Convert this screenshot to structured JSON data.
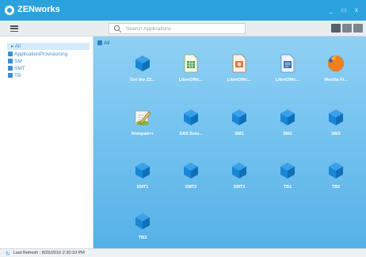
{
  "window": {
    "title": "ZENworks",
    "buttons": {
      "minimize": "_",
      "maximize": "▭",
      "close": "x"
    }
  },
  "toolbar": {
    "search_placeholder": "Search Applications",
    "icons": [
      "menu-icon",
      "search-icon",
      "list-view-icon",
      "grid-view-icon",
      "tile-view-icon"
    ]
  },
  "sidebar": {
    "items": [
      {
        "label": "All",
        "selected": true
      },
      {
        "label": "ApplicationProvisioning",
        "selected": false
      },
      {
        "label": "SM",
        "selected": false
      },
      {
        "label": "SMT",
        "selected": false
      },
      {
        "label": "TB",
        "selected": false
      }
    ]
  },
  "main": {
    "breadcrumb": "All",
    "tiles": [
      {
        "label": "Get the Z2...",
        "icon": "cube-icon"
      },
      {
        "label": "LibreOffic...",
        "icon": "libreoffice-calc-icon"
      },
      {
        "label": "LibreOffic...",
        "icon": "libreoffice-impress-icon"
      },
      {
        "label": "LibreOffic...",
        "icon": "libreoffice-writer-icon"
      },
      {
        "label": "Mozilla Fi...",
        "icon": "firefox-icon"
      },
      {
        "label": "Notepad++",
        "icon": "notepadpp-icon"
      },
      {
        "label": "SAS Setu...",
        "icon": "cube-icon"
      },
      {
        "label": "SM1",
        "icon": "cube-icon"
      },
      {
        "label": "SM2",
        "icon": "cube-icon"
      },
      {
        "label": "SM3",
        "icon": "cube-icon"
      },
      {
        "label": "SMT1",
        "icon": "cube-icon"
      },
      {
        "label": "SMT2",
        "icon": "cube-icon"
      },
      {
        "label": "SMT3",
        "icon": "cube-icon"
      },
      {
        "label": "TB1",
        "icon": "cube-icon"
      },
      {
        "label": "TB2",
        "icon": "cube-icon"
      },
      {
        "label": "TB3",
        "icon": "cube-icon"
      }
    ]
  },
  "status": {
    "text": "Last Refresh : 8/25/2016 2:20:10 PM"
  },
  "colors": {
    "brand": "#2aa3dd",
    "content_bg": "#6fc0ee",
    "cube": "#1a86d6",
    "link": "#3d8fd1"
  }
}
